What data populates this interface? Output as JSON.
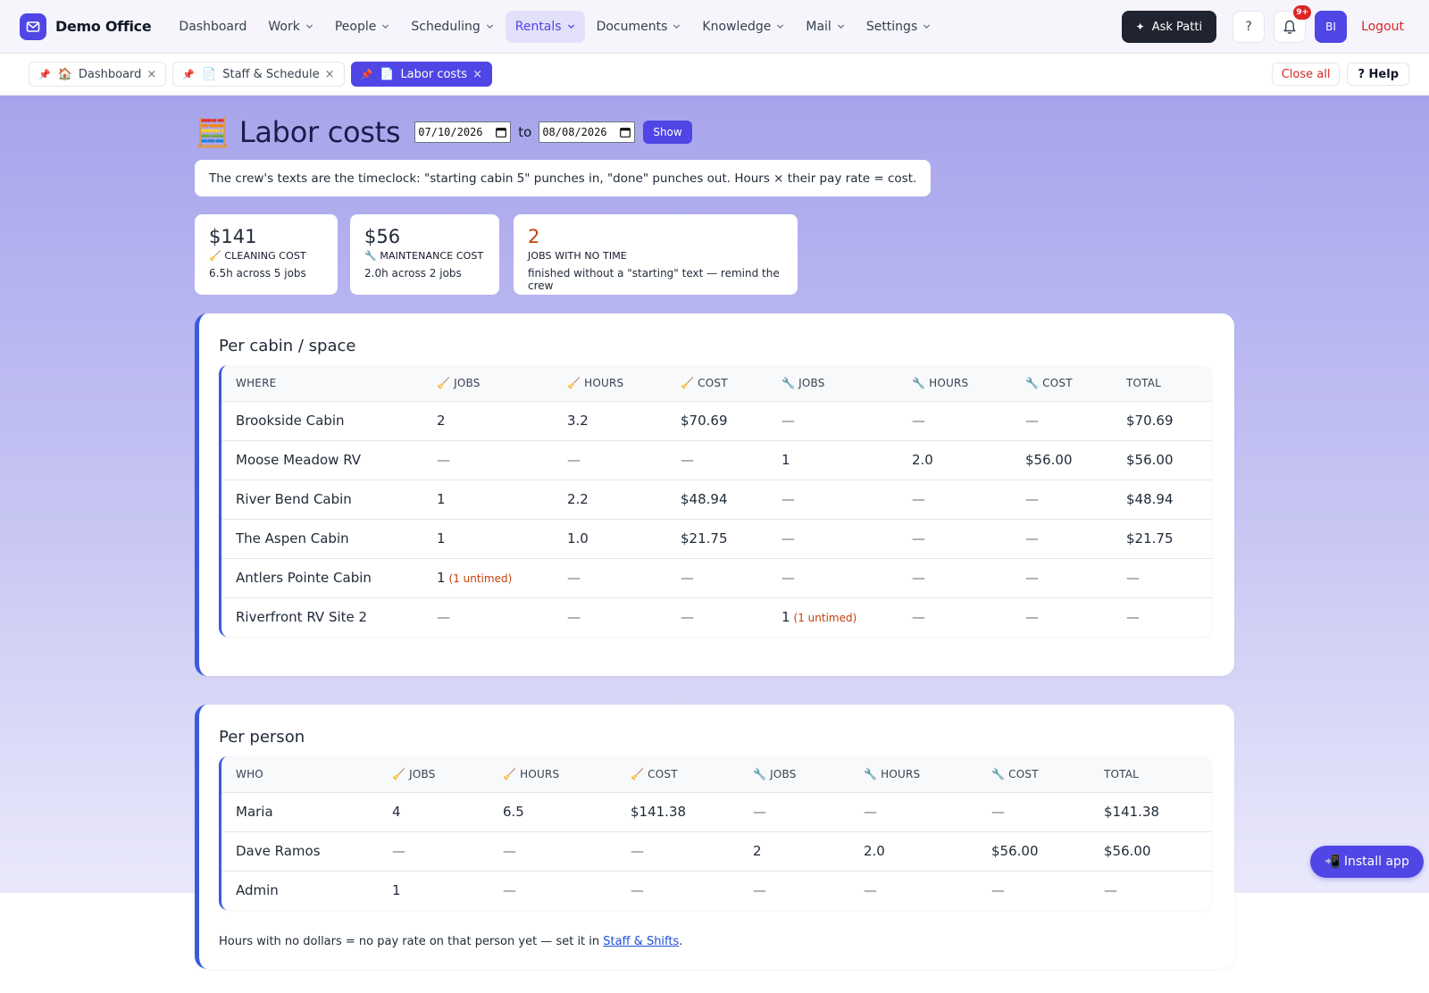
{
  "brand": {
    "name": "Demo Office",
    "logo_icon": "mail-icon"
  },
  "nav": {
    "items": [
      {
        "label": "Dashboard",
        "has_menu": false,
        "active": false
      },
      {
        "label": "Work",
        "has_menu": true,
        "active": false
      },
      {
        "label": "People",
        "has_menu": true,
        "active": false
      },
      {
        "label": "Scheduling",
        "has_menu": true,
        "active": false
      },
      {
        "label": "Rentals",
        "has_menu": true,
        "active": true
      },
      {
        "label": "Documents",
        "has_menu": true,
        "active": false
      },
      {
        "label": "Knowledge",
        "has_menu": true,
        "active": false
      },
      {
        "label": "Mail",
        "has_menu": true,
        "active": false
      },
      {
        "label": "Settings",
        "has_menu": true,
        "active": false
      }
    ],
    "ask_label": "Ask Patti",
    "help_label": "?",
    "notif_badge": "9+",
    "avatar_initials": "BI",
    "logout_label": "Logout"
  },
  "tabs": {
    "items": [
      {
        "emoji": "🏠",
        "label": "Dashboard",
        "active": false
      },
      {
        "emoji": "📄",
        "label": "Staff & Schedule",
        "active": false
      },
      {
        "emoji": "📄",
        "label": "Labor costs",
        "active": true
      }
    ],
    "pin_glyph": "📌",
    "close_glyph": "×",
    "close_all_label": "Close all",
    "help_label": "? Help"
  },
  "page": {
    "emoji": "🧮",
    "title": "Labor costs",
    "date_from": "07/10/2026",
    "date_to": "08/08/2026",
    "to_label": "to",
    "show_label": "Show",
    "info": "The crew's texts are the timeclock: \"starting cabin 5\" punches in, \"done\" punches out. Hours × their pay rate = cost."
  },
  "stats": [
    {
      "value": "$141",
      "label": "🧹 CLEANING COST",
      "sub": "6.5h across 5 jobs",
      "warn": false
    },
    {
      "value": "$56",
      "label": "🔧 MAINTENANCE COST",
      "sub": "2.0h across 2 jobs",
      "warn": false
    },
    {
      "value": "2",
      "label": "JOBS WITH NO TIME",
      "sub": "finished without a \"starting\" text — remind the crew",
      "warn": true
    }
  ],
  "per_cabin": {
    "title": "Per cabin / space",
    "columns": [
      "WHERE",
      "🧹 JOBS",
      "🧹 HOURS",
      "🧹 COST",
      "🔧 JOBS",
      "🔧 HOURS",
      "🔧 COST",
      "TOTAL"
    ],
    "rows": [
      {
        "cells": [
          "Brookside Cabin",
          "2",
          "3.2",
          "$70.69",
          "—",
          "—",
          "—",
          "$70.69"
        ]
      },
      {
        "cells": [
          "Moose Meadow RV",
          "—",
          "—",
          "—",
          "1",
          "2.0",
          "$56.00",
          "$56.00"
        ]
      },
      {
        "cells": [
          "River Bend Cabin",
          "1",
          "2.2",
          "$48.94",
          "—",
          "—",
          "—",
          "$48.94"
        ]
      },
      {
        "cells": [
          "The Aspen Cabin",
          "1",
          "1.0",
          "$21.75",
          "—",
          "—",
          "—",
          "$21.75"
        ]
      },
      {
        "cells": [
          "Antlers Pointe Cabin",
          "1",
          "—",
          "—",
          "—",
          "—",
          "—",
          "—"
        ],
        "untimed": {
          "col": 1,
          "text": "(1 untimed)"
        }
      },
      {
        "cells": [
          "Riverfront RV Site 2",
          "—",
          "—",
          "—",
          "1",
          "—",
          "—",
          "—"
        ],
        "untimed": {
          "col": 4,
          "text": "(1 untimed)"
        }
      }
    ]
  },
  "per_person": {
    "title": "Per person",
    "columns": [
      "WHO",
      "🧹 JOBS",
      "🧹 HOURS",
      "🧹 COST",
      "🔧 JOBS",
      "🔧 HOURS",
      "🔧 COST",
      "TOTAL"
    ],
    "rows": [
      {
        "cells": [
          "Maria",
          "4",
          "6.5",
          "$141.38",
          "—",
          "—",
          "—",
          "$141.38"
        ]
      },
      {
        "cells": [
          "Dave Ramos",
          "—",
          "—",
          "—",
          "2",
          "2.0",
          "$56.00",
          "$56.00"
        ]
      },
      {
        "cells": [
          "Admin",
          "1",
          "—",
          "—",
          "—",
          "—",
          "—",
          "—"
        ]
      }
    ],
    "footnote_prefix": "Hours with no dollars = no pay rate on that person yet — set it in ",
    "footnote_link": "Staff & Shifts",
    "footnote_suffix": "."
  },
  "install_label": "📲 Install app",
  "colors": {
    "accent": "#4f46e5",
    "warn": "#c2410c",
    "danger": "#dc2626",
    "card_border": "#3b5bdb"
  }
}
